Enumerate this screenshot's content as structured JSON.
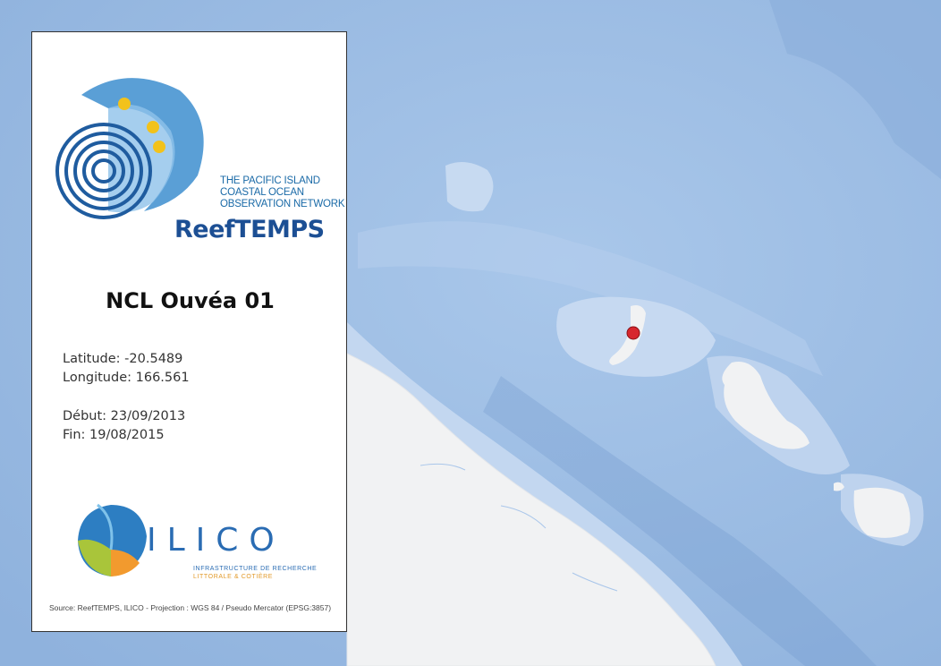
{
  "station": {
    "name": "NCL Ouvéa 01",
    "latitude": "Latitude: -20.5489",
    "longitude": "Longitude: 166.561",
    "start": "Début: 23/09/2013",
    "end": "Fin: 19/08/2015"
  },
  "reeftemps_logo": {
    "tagline": [
      "THE PACIFIC ISLAND",
      "COASTAL OCEAN",
      "OBSERVATION NETWORK"
    ],
    "name": "ReefTEMPS"
  },
  "ilico_logo": {
    "name": "ILICO",
    "subtitle_line1": "INFRASTRUCTURE DE RECHERCHE",
    "subtitle_line2": "LITTORALE & COTIÈRE"
  },
  "source": "Source: ReefTEMPS, ILICO - Projection : WGS 84 / Pseudo Mercator (EPSG:3857)",
  "colors": {
    "ocean": "#9fc0e6",
    "ocean_deep": "#8fb3de",
    "reef_shallow": "#c9dbf1",
    "land": "#f1f2f3",
    "station_marker": "#d7262d",
    "reeftemps_blue": "#1c4f94"
  },
  "marker": {
    "label": "station-marker"
  }
}
